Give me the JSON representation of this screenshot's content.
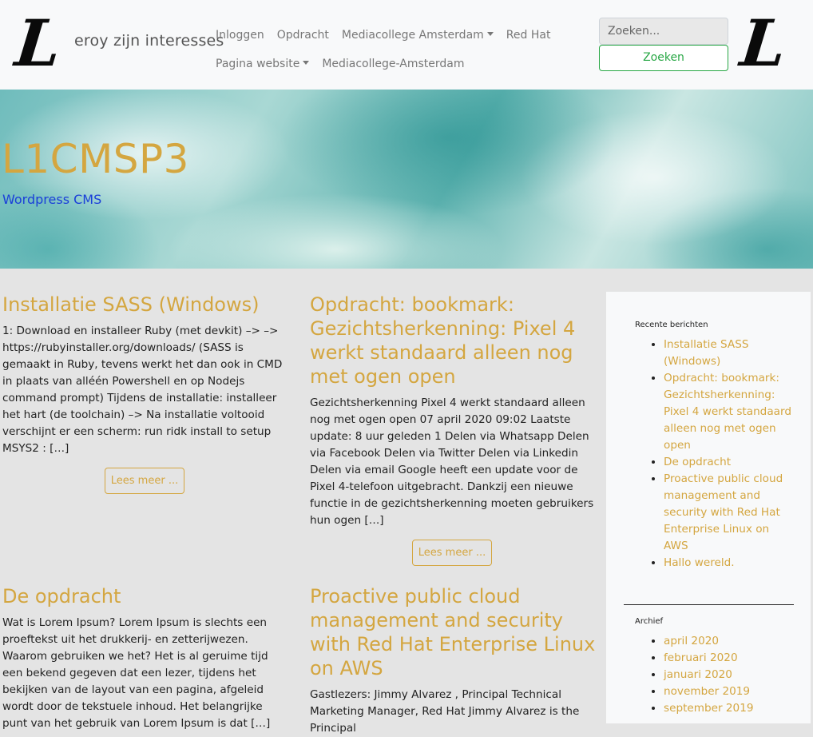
{
  "nav": {
    "logo_letter": "L",
    "brand": "eroy zijn interesses",
    "links_row1": [
      "Inloggen",
      "Opdracht",
      "Mediacollege Amsterdam",
      "Red Hat"
    ],
    "links_row2": [
      "Pagina website",
      "Mediacollege-Amsterdam"
    ],
    "dropdown_links": [
      "Mediacollege Amsterdam",
      "Pagina website"
    ],
    "search_placeholder": "Zoeken...",
    "search_button": "Zoeken"
  },
  "hero": {
    "title": "L1CMSP3",
    "subtitle": "Wordpress CMS"
  },
  "posts": [
    {
      "title": "Installatie SASS (Windows)",
      "excerpt": "1: Download en installeer Ruby (met devkit) –> –> https://rubyinstaller.org/downloads/ (SASS is gemaakt in Ruby, tevens werkt het dan ook in CMD in plaats van alléén Powershell en op Nodejs command prompt) Tijdens de installatie: installeer het hart (de toolchain) –> Na installatie voltooid verschijnt er een scherm: run ridk install to setup MSYS2 : […]",
      "read_more": "Lees meer ..."
    },
    {
      "title": "Opdracht: bookmark: Gezichtsherkenning: Pixel 4 werkt standaard alleen nog met ogen open",
      "excerpt": "  Gezichtsherkenning Pixel 4 werkt standaard alleen nog met ogen open 07 april 2020 09:02 Laatste update: 8 uur geleden 1 Delen via Whatsapp Delen via Facebook Delen via Twitter Delen via Linkedin Delen via email Google heeft een update voor de Pixel 4-telefoon uitgebracht. Dankzij een nieuwe functie in de gezichtsherkenning moeten gebruikers hun ogen […]",
      "read_more": "Lees meer ..."
    },
    {
      "title": "De opdracht",
      "excerpt": "Wat is Lorem Ipsum? Lorem Ipsum is slechts een proeftekst uit het drukkerij- en zetterijwezen. Waarom gebruiken we het? Het is al geruime tijd een bekend gegeven dat een lezer, tijdens het bekijken van de layout van een pagina, afgeleid wordt door de tekstuele inhoud. Het belangrijke punt van het gebruik van Lorem Ipsum is dat […]"
    },
    {
      "title": "Proactive public cloud management and security with Red Hat Enterprise Linux on AWS",
      "excerpt": "Gastlezers: Jimmy Alvarez , Principal Technical Marketing Manager, Red Hat Jimmy Alvarez is the Principal"
    }
  ],
  "sidebar": {
    "recent_title": "Recente berichten",
    "recent": [
      "Installatie SASS (Windows)",
      "Opdracht: bookmark: Gezichtsherkenning: Pixel 4 werkt standaard alleen nog met ogen open",
      "De opdracht",
      "Proactive public cloud management and security with Red Hat Enterprise Linux on AWS",
      "Hallo wereld."
    ],
    "archive_title": "Archief",
    "archive": [
      "april 2020",
      "februari 2020",
      "januari 2020",
      "november 2019",
      "september 2019"
    ]
  },
  "colors": {
    "accent": "#d4a640",
    "subtitle_blue": "#1a3fd9",
    "search_green": "#28a745"
  }
}
